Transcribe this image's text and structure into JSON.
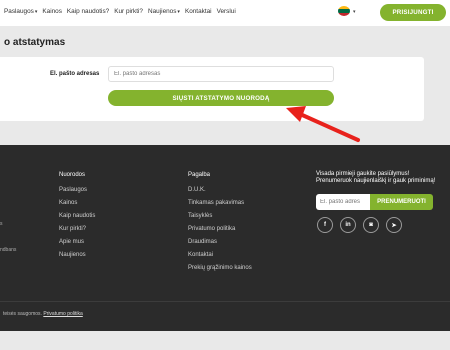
{
  "nav": {
    "items": [
      {
        "label": "Paslaugos",
        "caret": "▾"
      },
      {
        "label": "Kainos",
        "caret": ""
      },
      {
        "label": "Kaip naudotis?",
        "caret": ""
      },
      {
        "label": "Kur pirkti?",
        "caret": ""
      },
      {
        "label": "Naujienos",
        "caret": "▾"
      },
      {
        "label": "Kontaktai",
        "caret": ""
      },
      {
        "label": "Verslui",
        "caret": ""
      }
    ],
    "language_caret": "▾",
    "login_label": "PRISIJUNGTI"
  },
  "colors": {
    "accent": "#84b32e",
    "arrow": "#e8221c",
    "footer_bg": "#2b2b2b"
  },
  "page": {
    "title": "o atstatymas"
  },
  "form": {
    "email_label": "El. pašto adresas",
    "email_placeholder": "El. pašto adresas",
    "submit_label": "SIŲSTI ATSTATYMO NUORODĄ"
  },
  "footer": {
    "links_heading": "Nuorodos",
    "links": [
      "Paslaugos",
      "Kainos",
      "Kaip naudotis",
      "Kur pirkti?",
      "Apie mus",
      "Naujienos"
    ],
    "help_heading": "Pagalba",
    "help": [
      "D.U.K.",
      "Tinkamas pakavimas",
      "Taisyklės",
      "Privatumo politika",
      "Draudimas",
      "Kontaktai",
      "Prekių grąžinimo kainos"
    ],
    "stub1": "s",
    "stub2": "ndbans",
    "newsletter_title": "Visada pirmieji gaukite pasiūlymus! Prenumeruok naujienlaiškį ir gauk priminimą!",
    "newsletter_placeholder": "El. pašto adres",
    "newsletter_button": "PRENUMERUOTI",
    "socials": [
      "f",
      "in",
      "◙",
      "➤"
    ],
    "copyright_text": "teisės saugomos.",
    "privacy_link": "Privatumo politika"
  }
}
